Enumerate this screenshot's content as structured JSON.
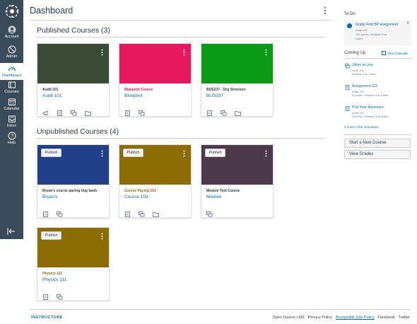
{
  "nav": {
    "items": [
      {
        "label": "Account",
        "icon": "account-icon"
      },
      {
        "label": "Admin",
        "icon": "admin-icon"
      },
      {
        "label": "Dashboard",
        "icon": "dashboard-icon"
      },
      {
        "label": "Courses",
        "icon": "courses-icon"
      },
      {
        "label": "Calendar",
        "icon": "calendar-icon"
      },
      {
        "label": "Inbox",
        "icon": "inbox-icon"
      },
      {
        "label": "Help",
        "icon": "help-icon"
      }
    ],
    "active_index": 2,
    "bg_color": "#394b58"
  },
  "header": {
    "title": "Dashboard"
  },
  "published": {
    "heading": "Published Courses (3)",
    "cards": [
      {
        "name": "Audit 101",
        "code": "Audit 101",
        "color": "#3a4a36",
        "name_color": "#2d3b45",
        "icons": [
          "announcements-icon",
          "assignments-icon",
          "discussions-icon",
          "files-icon"
        ]
      },
      {
        "name": "Blueprint Course",
        "code": "Blueprint",
        "color": "#e8185e",
        "name_color": "#e8185e",
        "icons": [
          "assignments-icon",
          "discussions-icon"
        ]
      },
      {
        "name": "BUS337 - Org Structure",
        "code": "BUS337",
        "color": "#0b9a16",
        "name_color": "#2d3b45",
        "icons": [
          "assignments-icon",
          "discussions-icon",
          "files-icon"
        ]
      }
    ]
  },
  "unpublished": {
    "heading": "Unpublished Courses (4)",
    "publish_label": "Publish",
    "cards": [
      {
        "name": "Bryan's course pacing bug bash",
        "code": "Bryan's",
        "color": "#223f8a",
        "name_color": "#2d3b45",
        "icons": [
          "assignments-icon",
          "discussions-icon"
        ]
      },
      {
        "name": "Course Pacing 103",
        "code": "Course 103",
        "color": "#8b6d04",
        "name_color": "#8b6d04",
        "icons": [
          "assignments-icon",
          "discussions-icon",
          "files-icon"
        ]
      },
      {
        "name": "Module Test Course",
        "code": "Module",
        "color": "#4b3a4a",
        "name_color": "#2d3b45",
        "icons": [
          "discussions-icon"
        ]
      },
      {
        "name": "Physics 111",
        "code": "Physics 111",
        "color": "#8b6d04",
        "name_color": "#8b6d04",
        "icons": [
          "assignments-icon",
          "discussions-icon"
        ]
      }
    ]
  },
  "sidebar": {
    "todo_heading": "To Do",
    "todo": {
      "title": "Grade First BP assignment",
      "course": "Audit 101",
      "detail": "100 points • Multiple Due",
      "detail2": "Dates"
    },
    "coming_up_heading": "Coming Up",
    "view_calendar": "View Calendar",
    "coming_up": [
      {
        "title": "Jokes on you",
        "course": "Audit 101",
        "detail": "Multiple Due Dates",
        "icon": "discussion-icon"
      },
      {
        "title": "Assignment 101",
        "course": "Audit 101",
        "detail": "5 points • Multiple Due Dates",
        "icon": "assignment-icon"
      },
      {
        "title": "Pick Your Adventure",
        "course": "Audit 101",
        "detail": "5 points • Multiple Due Dates",
        "icon": "assignment-icon"
      }
    ],
    "more_link": "4 more in the next week...",
    "start_course": "Start a New Course",
    "view_grades": "View Grades"
  },
  "footer": {
    "logo": "INSTRUCTURE",
    "links": [
      "Open Source LMS",
      "Privacy Policy",
      "Acceptable Use Policy",
      "Facebook",
      "Twitter"
    ]
  }
}
